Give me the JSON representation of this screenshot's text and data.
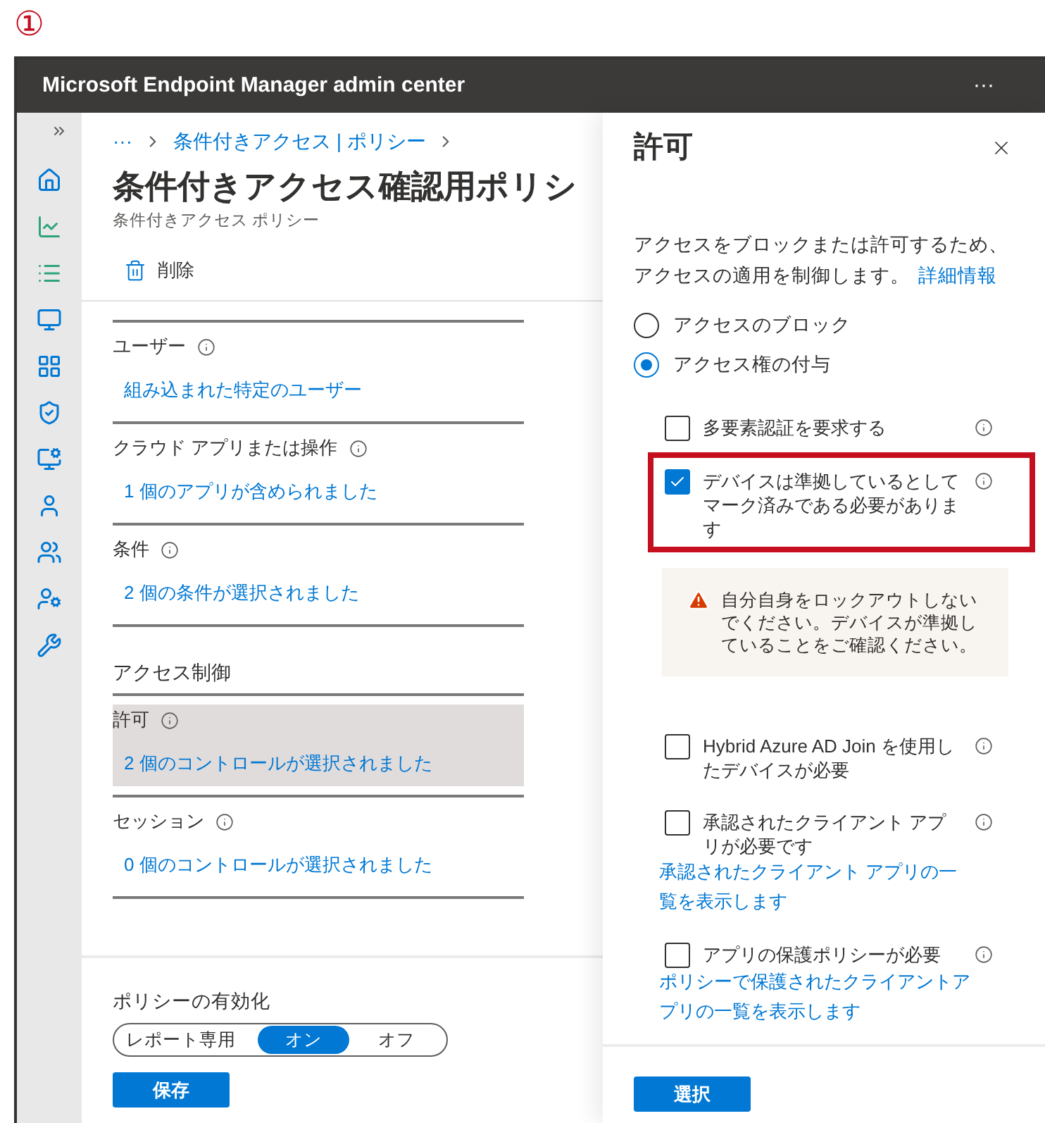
{
  "annotation_label": "①",
  "window": {
    "title": "Microsoft Endpoint Manager admin center",
    "more": "···"
  },
  "breadcrumb": {
    "ellipsis": "···",
    "items": [
      "条件付きアクセス | ポリシー"
    ]
  },
  "page": {
    "title": "条件付きアクセス確認用ポリシ",
    "subtitle": "条件付きアクセス ポリシー",
    "toolbar": [
      {
        "label": "削除"
      }
    ]
  },
  "sections": [
    {
      "kind": "field",
      "label": "ユーザー",
      "value": "組み込まれた特定のユーザー",
      "selected": false
    },
    {
      "kind": "field",
      "label": "クラウド アプリまたは操作",
      "value": "1 個のアプリが含められました",
      "selected": false
    },
    {
      "kind": "field",
      "label": "条件",
      "value": "2 個の条件が選択されました",
      "selected": false
    },
    {
      "kind": "heading",
      "label": "アクセス制御"
    },
    {
      "kind": "field",
      "label": "許可",
      "value": "2 個のコントロールが選択されました",
      "selected": true
    },
    {
      "kind": "field",
      "label": "セッション",
      "value": "0 個のコントロールが選択されました",
      "selected": false
    }
  ],
  "footer": {
    "label": "ポリシーの有効化",
    "options": [
      {
        "label": "レポート専用",
        "selected": false
      },
      {
        "label": "オン",
        "selected": true
      },
      {
        "label": "オフ",
        "selected": false
      }
    ],
    "save": "保存"
  },
  "panel": {
    "title": "許可",
    "description": "アクセスをブロックまたは許可するため、アクセスの適用を制御します。",
    "learn_more": "詳細情報",
    "radios": [
      {
        "label": "アクセスのブロック",
        "selected": false
      },
      {
        "label": "アクセス権の付与",
        "selected": true
      }
    ],
    "options": [
      {
        "label": "多要素認証を要求する",
        "checked": false,
        "highlighted": false
      },
      {
        "label": "デバイスは準拠しているとしてマーク済みである必要があります",
        "checked": true,
        "highlighted": true,
        "warning": "自分自身をロックアウトしないでください。デバイスが準拠していることをご確認ください。"
      },
      {
        "label": "Hybrid Azure AD Join を使用したデバイスが必要",
        "checked": false,
        "highlighted": false
      },
      {
        "label": "承認されたクライアント アプリが必要です",
        "checked": false,
        "highlighted": false,
        "link": "承認されたクライアント アプリの一覧を表示します"
      },
      {
        "label": "アプリの保護ポリシーが必要",
        "checked": false,
        "highlighted": false,
        "link": "ポリシーで保護されたクライアントアプリの一覧を表示します"
      }
    ],
    "select": "選択"
  }
}
